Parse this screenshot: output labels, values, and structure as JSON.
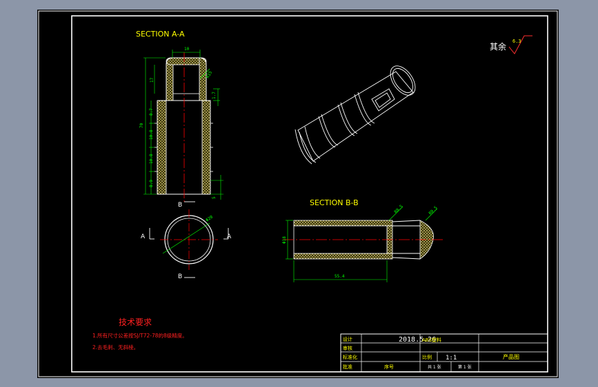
{
  "colors": {
    "background": "#000000",
    "frame": "#ffffff",
    "dimension": "#00ff00",
    "centerline": "#ff0000",
    "hatch": "#e8e080",
    "title_text": "#ffff00",
    "notes": "#ff2020",
    "roughness_mark": "#ff3030"
  },
  "section_aa": {
    "title": "SECTION A-A",
    "dims": {
      "top_width": "10",
      "top_slot": "17",
      "right_a": "R15",
      "right_b": "1.7",
      "left_1": "8.7",
      "left_2": "10.8",
      "left_3": "10.8",
      "left_4": "8.9",
      "overall": "70",
      "bottom_right": "5"
    }
  },
  "circle_view": {
    "label_a_left": "A",
    "label_a_right": "A",
    "label_b_top": "B",
    "label_b_bottom": "B",
    "diameter": "Φ20"
  },
  "section_bb": {
    "title": "SECTION B-B",
    "dims": {
      "height": "Φ18",
      "length": "55.4",
      "chamfer_a": "R0.5",
      "chamfer_b": "R0.5"
    }
  },
  "roughness": {
    "label": "其余",
    "value": "6.3"
  },
  "tech_notes": {
    "heading": "技术要求",
    "items": [
      "1.所有尺寸公差按SJ/T72-78的8级精度。",
      "2.去毛刺、无斜棱。"
    ]
  },
  "title_block": {
    "design_label": "设计",
    "check_label": "审核",
    "standard_label": "标准化",
    "approve_label": "批准",
    "date": "2018.5.26",
    "material": "ABS塑料",
    "scale_label": "比例",
    "scale_value": "1:1",
    "product_name": "产品图",
    "sheet_total": "共 1 张",
    "sheet_index": "第 1 张",
    "drawing_no_label": "序号"
  }
}
